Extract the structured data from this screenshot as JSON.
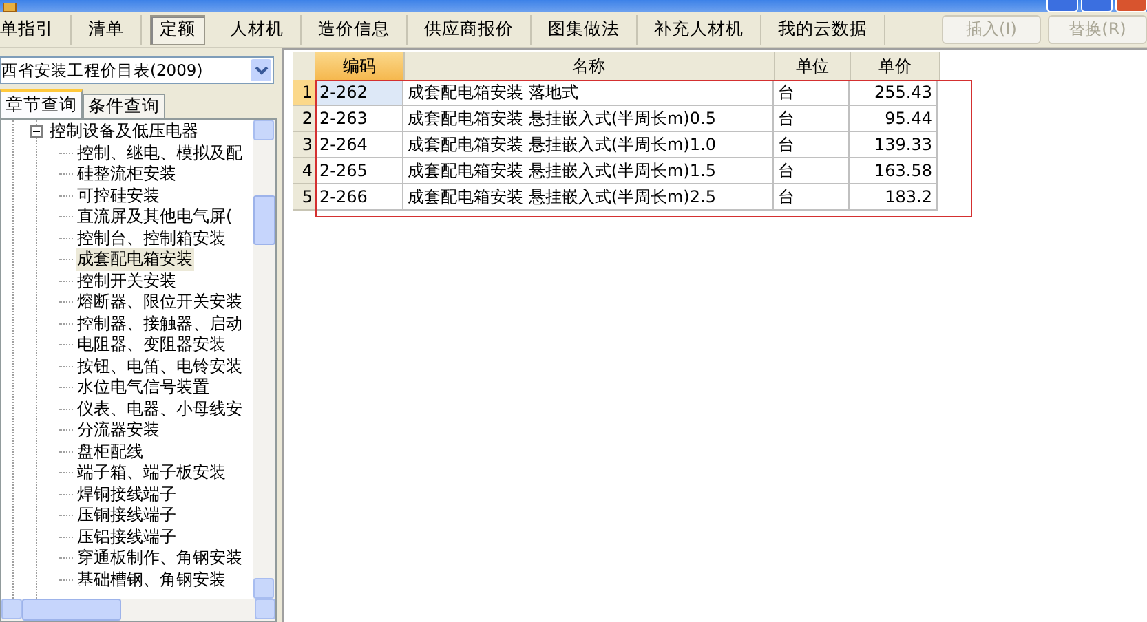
{
  "tabs": [
    {
      "label": "单指引",
      "selected": false
    },
    {
      "label": "清单",
      "selected": false
    },
    {
      "label": "定额",
      "selected": true
    },
    {
      "label": "人材机",
      "selected": false
    },
    {
      "label": "造价信息",
      "selected": false
    },
    {
      "label": "供应商报价",
      "selected": false
    },
    {
      "label": "图集做法",
      "selected": false
    },
    {
      "label": "补充人材机",
      "selected": false
    },
    {
      "label": "我的云数据",
      "selected": false
    }
  ],
  "actions": [
    {
      "label": "插入(I)",
      "disabled": true
    },
    {
      "label": "替换(R)",
      "disabled": true
    }
  ],
  "library_select": {
    "value": "西省安装工程价目表(2009)"
  },
  "query_tabs": [
    {
      "label": "章节查询",
      "selected": true
    },
    {
      "label": "条件查询",
      "selected": false
    }
  ],
  "tree": [
    {
      "label": "控制设备及低压电器",
      "expanded": true,
      "selected": false,
      "children": [
        {
          "label": "控制、继电、模拟及配",
          "selected": false
        },
        {
          "label": "硅整流柜安装",
          "selected": false
        },
        {
          "label": "可控硅安装",
          "selected": false
        },
        {
          "label": "直流屏及其他电气屏(",
          "selected": false
        },
        {
          "label": "控制台、控制箱安装",
          "selected": false
        },
        {
          "label": "成套配电箱安装",
          "selected": true
        },
        {
          "label": "控制开关安装",
          "selected": false
        },
        {
          "label": "熔断器、限位开关安装",
          "selected": false
        },
        {
          "label": "控制器、接触器、启动",
          "selected": false
        },
        {
          "label": "电阻器、变阻器安装",
          "selected": false
        },
        {
          "label": "按钮、电笛、电铃安装",
          "selected": false
        },
        {
          "label": "水位电气信号装置",
          "selected": false
        },
        {
          "label": "仪表、电器、小母线安",
          "selected": false
        },
        {
          "label": "分流器安装",
          "selected": false
        },
        {
          "label": "盘柜配线",
          "selected": false
        },
        {
          "label": "端子箱、端子板安装",
          "selected": false
        },
        {
          "label": "焊铜接线端子",
          "selected": false
        },
        {
          "label": "压铜接线端子",
          "selected": false
        },
        {
          "label": "压铝接线端子",
          "selected": false
        },
        {
          "label": "穿通板制作、角钢安装",
          "selected": false
        },
        {
          "label": "基础槽钢、角钢安装",
          "selected": false
        }
      ]
    }
  ],
  "table": {
    "columns": [
      "编码",
      "名称",
      "单位",
      "单价"
    ],
    "rows": [
      {
        "index": "1",
        "code": "2-262",
        "name": "成套配电箱安装 落地式",
        "unit": "台",
        "price": "255.43",
        "selected": true
      },
      {
        "index": "2",
        "code": "2-263",
        "name": "成套配电箱安装 悬挂嵌入式(半周长m)0.5",
        "unit": "台",
        "price": "95.44",
        "selected": false
      },
      {
        "index": "3",
        "code": "2-264",
        "name": "成套配电箱安装 悬挂嵌入式(半周长m)1.0",
        "unit": "台",
        "price": "139.33",
        "selected": false
      },
      {
        "index": "4",
        "code": "2-265",
        "name": "成套配电箱安装 悬挂嵌入式(半周长m)1.5",
        "unit": "台",
        "price": "163.58",
        "selected": false
      },
      {
        "index": "5",
        "code": "2-266",
        "name": "成套配电箱安装 悬挂嵌入式(半周长m)2.5",
        "unit": "台",
        "price": "183.2",
        "selected": false
      }
    ]
  }
}
